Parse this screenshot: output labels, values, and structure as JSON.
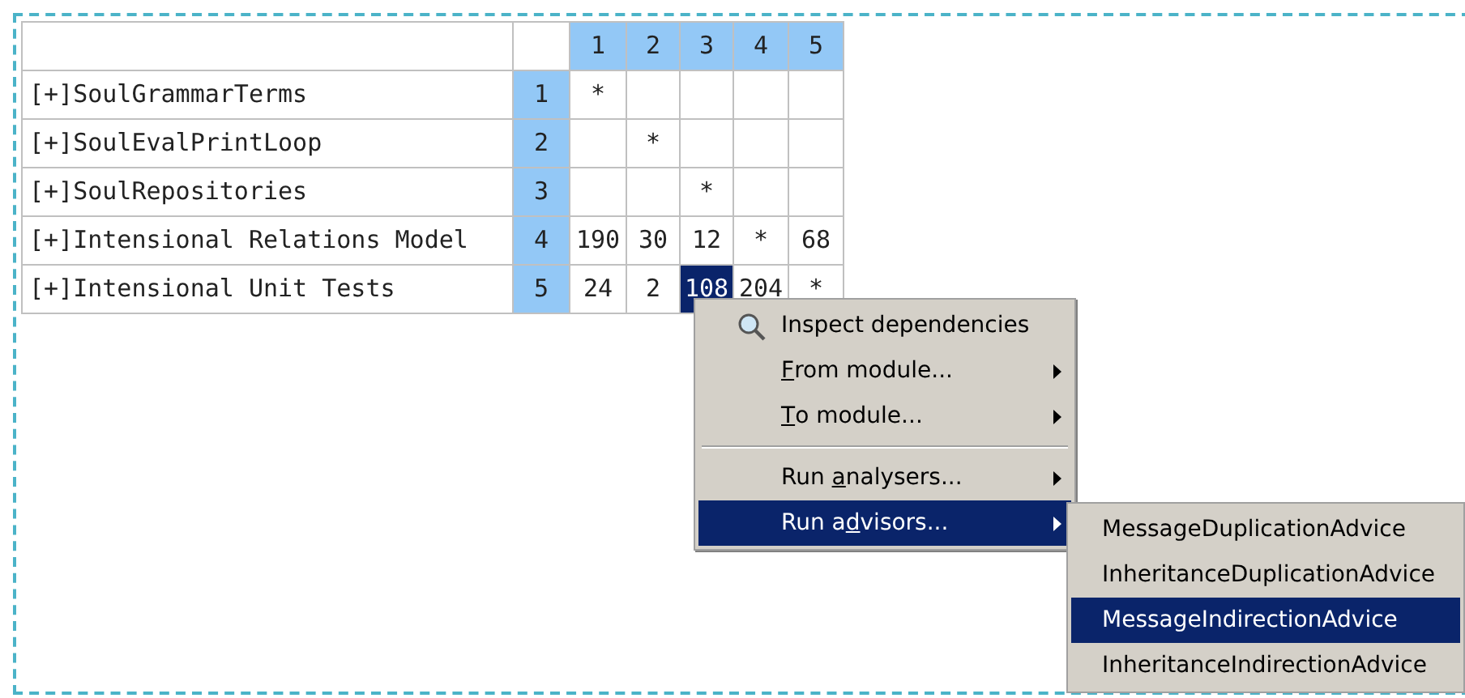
{
  "matrix": {
    "columns": [
      "1",
      "2",
      "3",
      "4",
      "5"
    ],
    "rows": [
      {
        "name": "[+]SoulGrammarTerms",
        "index": "1",
        "cells": [
          {
            "text": "*",
            "selected": false
          },
          {
            "text": "",
            "selected": false
          },
          {
            "text": "",
            "selected": false
          },
          {
            "text": "",
            "selected": false
          },
          {
            "text": "",
            "selected": false
          }
        ]
      },
      {
        "name": "[+]SoulEvalPrintLoop",
        "index": "2",
        "cells": [
          {
            "text": "",
            "selected": false
          },
          {
            "text": "*",
            "selected": false
          },
          {
            "text": "",
            "selected": false
          },
          {
            "text": "",
            "selected": false
          },
          {
            "text": "",
            "selected": false
          }
        ]
      },
      {
        "name": "[+]SoulRepositories",
        "index": "3",
        "cells": [
          {
            "text": "",
            "selected": false
          },
          {
            "text": "",
            "selected": false
          },
          {
            "text": "*",
            "selected": false
          },
          {
            "text": "",
            "selected": false
          },
          {
            "text": "",
            "selected": false
          }
        ]
      },
      {
        "name": "[+]Intensional Relations Model",
        "index": "4",
        "cells": [
          {
            "text": "190",
            "selected": false
          },
          {
            "text": "30",
            "selected": false
          },
          {
            "text": "12",
            "selected": false
          },
          {
            "text": "*",
            "selected": false
          },
          {
            "text": "68",
            "selected": false
          }
        ]
      },
      {
        "name": "[+]Intensional Unit Tests",
        "index": "5",
        "cells": [
          {
            "text": "24",
            "selected": false
          },
          {
            "text": "2",
            "selected": false
          },
          {
            "text": "108",
            "selected": true
          },
          {
            "text": "204",
            "selected": false
          },
          {
            "text": "*",
            "selected": false
          }
        ]
      }
    ]
  },
  "context_menu": {
    "items": [
      {
        "kind": "item",
        "before": "Inspect dependencies",
        "icon": true,
        "submenu": false,
        "selected": false
      },
      {
        "kind": "item",
        "mnemonic": "F",
        "after": "rom module...",
        "icon": false,
        "submenu": true,
        "selected": false
      },
      {
        "kind": "item",
        "mnemonic": "T",
        "after": "o module...",
        "icon": false,
        "submenu": true,
        "selected": false
      },
      {
        "kind": "separator"
      },
      {
        "kind": "item",
        "before": "Run ",
        "mnemonic": "a",
        "after": "nalysers...",
        "icon": false,
        "submenu": true,
        "selected": false
      },
      {
        "kind": "item",
        "before": "Run a",
        "mnemonic": "d",
        "after": "visors...",
        "icon": false,
        "submenu": true,
        "selected": true
      }
    ]
  },
  "submenu": {
    "items": [
      {
        "label": "MessageDuplicationAdvice",
        "selected": false
      },
      {
        "label": "InheritanceDuplicationAdvice",
        "selected": false
      },
      {
        "label": "MessageIndirectionAdvice",
        "selected": true
      },
      {
        "label": "InheritanceIndirectionAdvice",
        "selected": false
      }
    ]
  }
}
